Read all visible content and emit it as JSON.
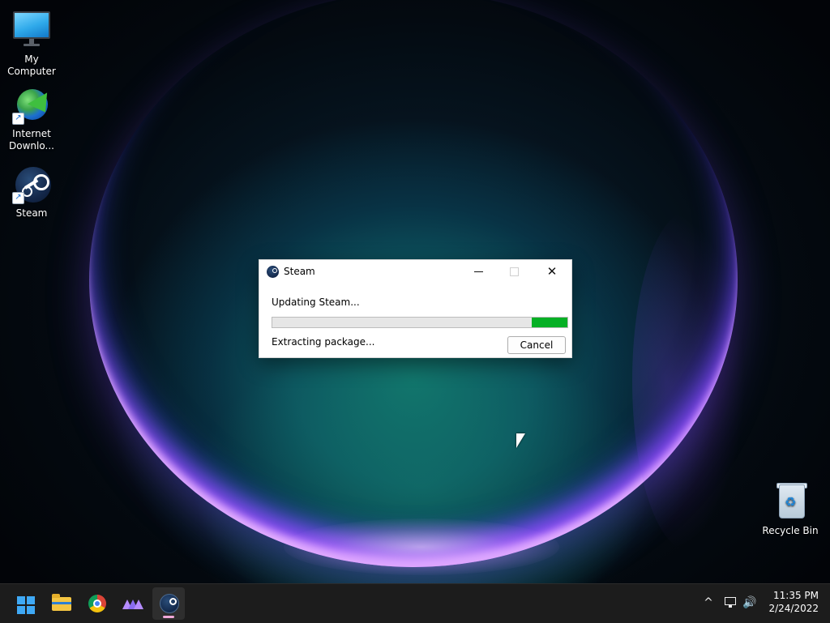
{
  "desktop": {
    "icons": [
      {
        "label": "My Computer"
      },
      {
        "label": "Internet\nDownlo..."
      },
      {
        "label": "Steam"
      },
      {
        "label": "Recycle Bin"
      }
    ]
  },
  "dialog": {
    "title": "Steam",
    "status": "Updating Steam...",
    "progress_fraction": 0.12,
    "substatus": "Extracting package...",
    "cancel_label": "Cancel",
    "progress_color": "#06b025"
  },
  "taskbar": {
    "apps": [
      "start-icon",
      "file-explorer-icon",
      "chrome-icon",
      "mountain-app-icon",
      "steam-icon"
    ],
    "accent": "#3fa9f5"
  },
  "tray": {
    "time": "11:35 PM",
    "date": "2/24/2022"
  }
}
